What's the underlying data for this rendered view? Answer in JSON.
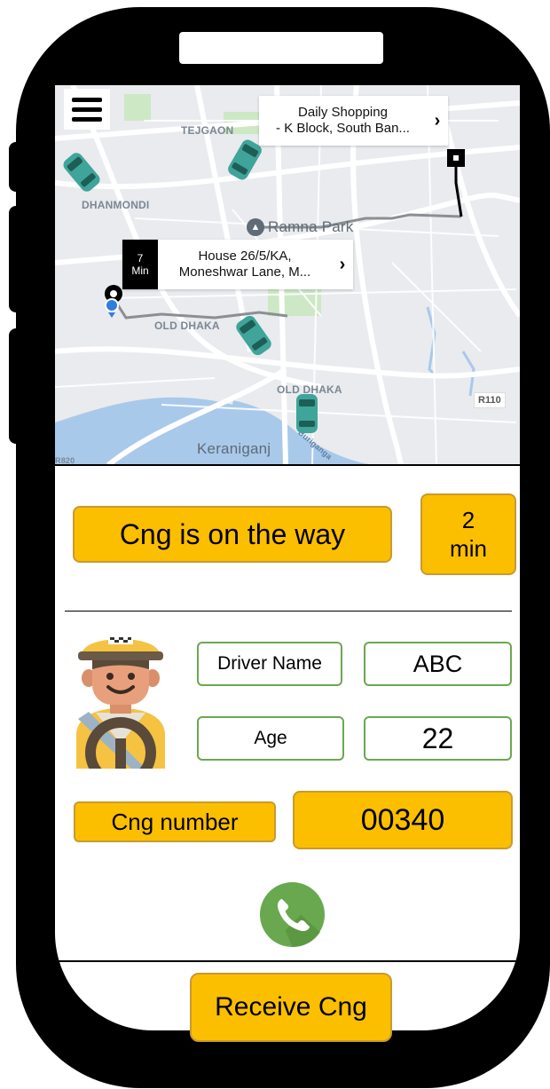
{
  "map": {
    "labels": {
      "tejgaon": "TEJGAON",
      "dhanmondi": "DHANMONDI",
      "ramna_park": "Ramna Park",
      "old_dhaka_1": "OLD DHAKA",
      "old_dhaka_2": "OLD DHAKA",
      "keraniganj": "Keraniganj",
      "route": "R110",
      "edge_tag": "R820",
      "river": "Buriganga"
    },
    "destination": {
      "line1": "Daily Shopping",
      "line2": "- K Block, South Ban..."
    },
    "pickup": {
      "eta_value": "7",
      "eta_unit": "Min",
      "line1": "House 26/5/KA,",
      "line2": "Moneshwar Lane, M..."
    },
    "chevron": "›"
  },
  "status": {
    "message": "Cng is on the way",
    "time_value": "2",
    "time_unit": "min"
  },
  "driver": {
    "name_label": "Driver Name",
    "name_value": "ABC",
    "age_label": "Age",
    "age_value": "22"
  },
  "cng": {
    "number_label": "Cng number",
    "number_value": "00340"
  },
  "actions": {
    "receive_label": "Receive Cng"
  },
  "colors": {
    "accent_yellow": "#fbbf00",
    "field_border_green": "#6aa84f",
    "call_green": "#6aa84f",
    "car_teal": "#3fa49a",
    "map_bg": "#e9ebee"
  },
  "icons": {
    "menu": "hamburger-menu-icon",
    "call": "phone-call-icon",
    "avatar": "driver-avatar",
    "car": "car-marker-icon",
    "pickup_pin": "pickup-pin-icon",
    "destination": "destination-marker-icon"
  }
}
